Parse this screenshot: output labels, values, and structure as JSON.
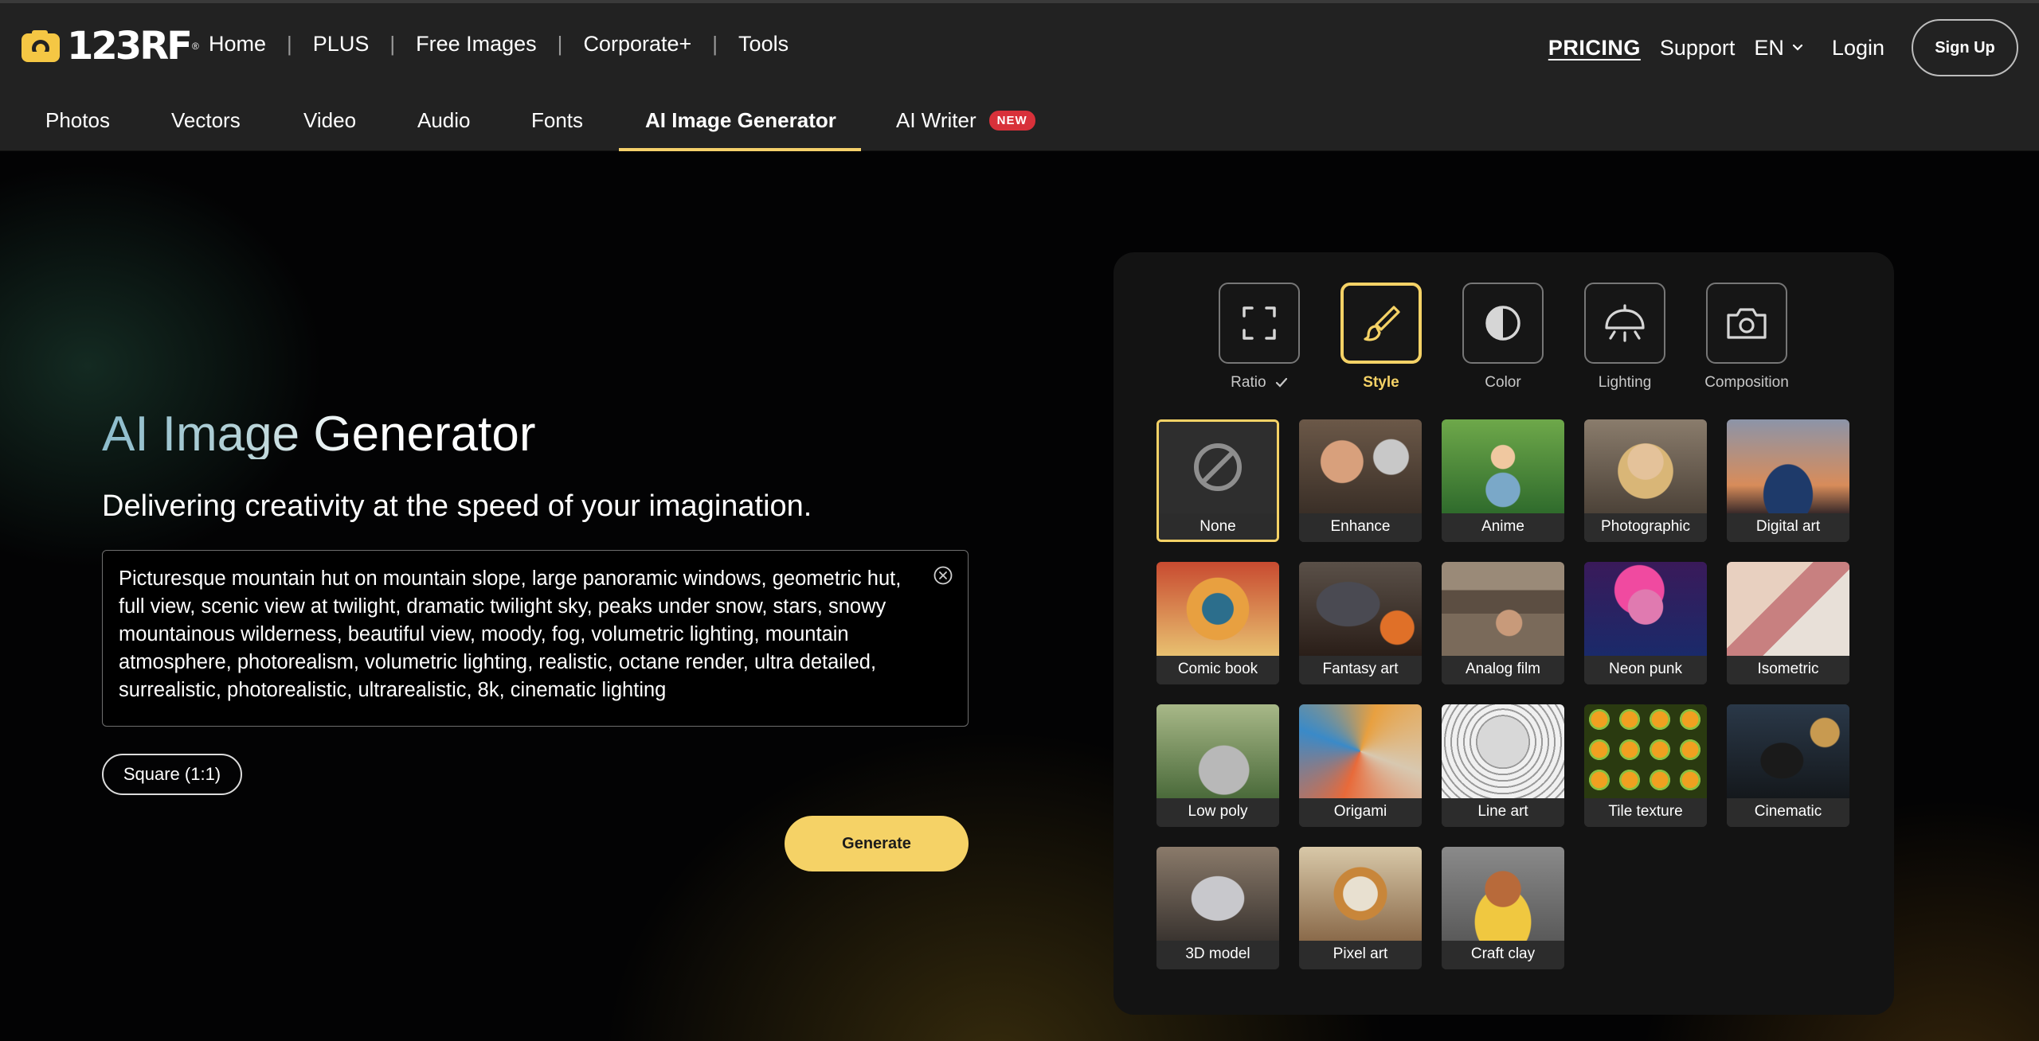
{
  "header": {
    "logo_text": "123RF",
    "nav": [
      {
        "label": "Home"
      },
      {
        "label": "PLUS"
      },
      {
        "label": "Free Images"
      },
      {
        "label": "Corporate+"
      },
      {
        "label": "Tools"
      }
    ],
    "separator": "|",
    "pricing": "PRICING",
    "support": "Support",
    "language": "EN",
    "login": "Login",
    "signup": "Sign Up"
  },
  "categories": [
    {
      "label": "Photos"
    },
    {
      "label": "Vectors"
    },
    {
      "label": "Video"
    },
    {
      "label": "Audio"
    },
    {
      "label": "Fonts"
    },
    {
      "label": "AI Image Generator",
      "active": true
    },
    {
      "label": "AI Writer",
      "badge": "NEW"
    }
  ],
  "hero": {
    "title": "AI Image Generator",
    "subtitle": "Delivering creativity at the speed of your imagination.",
    "prompt": "Picturesque mountain hut on mountain slope, large panoramic windows, geometric hut, full view, scenic view at twilight, dramatic twilight sky, peaks under snow, stars, snowy mountainous wilderness, beautiful view, moody, fog, volumetric lighting, mountain atmosphere, photorealism, volumetric lighting, realistic, octane render, ultra detailed, surrealistic, photorealistic, ultrarealistic, 8k, cinematic lighting",
    "ratio": "Square (1:1)",
    "generate": "Generate"
  },
  "panel": {
    "tools": [
      {
        "label": "Ratio",
        "icon": "fullscreen-icon",
        "checked": true
      },
      {
        "label": "Style",
        "icon": "brush-icon",
        "active": true
      },
      {
        "label": "Color",
        "icon": "contrast-icon"
      },
      {
        "label": "Lighting",
        "icon": "lamp-icon"
      },
      {
        "label": "Composition",
        "icon": "camera-icon"
      }
    ],
    "styles": [
      {
        "label": "None",
        "selected": true
      },
      {
        "label": "Enhance"
      },
      {
        "label": "Anime"
      },
      {
        "label": "Photographic"
      },
      {
        "label": "Digital art"
      },
      {
        "label": "Comic book"
      },
      {
        "label": "Fantasy art"
      },
      {
        "label": "Analog film"
      },
      {
        "label": "Neon punk"
      },
      {
        "label": "Isometric"
      },
      {
        "label": "Low poly"
      },
      {
        "label": "Origami"
      },
      {
        "label": "Line art"
      },
      {
        "label": "Tile texture"
      },
      {
        "label": "Cinematic"
      },
      {
        "label": "3D model"
      },
      {
        "label": "Pixel art"
      },
      {
        "label": "Craft clay"
      }
    ]
  },
  "colors": {
    "accent": "#f5d266",
    "badge": "#d8313a",
    "bar": "#222222"
  }
}
